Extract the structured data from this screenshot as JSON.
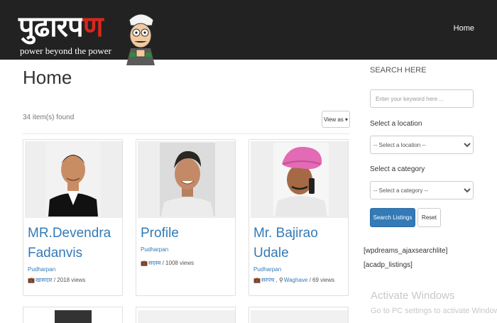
{
  "header": {
    "logo_text_main": "पुढारप",
    "logo_text_accent": "ण",
    "logo_tagline": "power beyond the power",
    "nav": [
      {
        "label": "Home"
      }
    ]
  },
  "main": {
    "title": "Home",
    "count_text": "34 item(s) found",
    "view_as_label": "View as ▾",
    "cards": [
      {
        "name": "MR.Devendra Fadanvis",
        "author": "Pudharpan",
        "category": "खासदार",
        "views": "/ 2018 views"
      },
      {
        "name": "Profile",
        "author": "Pudharpan",
        "category": "सदस्य",
        "views": "/ 1008 views"
      },
      {
        "name": "Mr. Bajirao Udale",
        "author": "Pudharpan",
        "category": "सरपंच",
        "location": "Waghave",
        "views": "/ 69 views"
      }
    ]
  },
  "sidebar": {
    "title": "SEARCH HERE",
    "keyword_placeholder": "Enter your keyword here ...",
    "location_label": "Select a location",
    "location_selected": "-- Select a location --",
    "category_label": "Select a category",
    "category_selected": "-- Select a category --",
    "search_button": "Search Listings",
    "reset_button": "Reset",
    "shortcode_1": "[wpdreams_ajaxsearchlite]",
    "shortcode_2": "[acadp_listings]"
  },
  "watermark": {
    "title": "Activate Windows",
    "subtitle": "Go to PC settings to activate Windows."
  },
  "colors": {
    "header_bg": "#222222",
    "accent_red": "#d9261c",
    "link_blue": "#337ab7"
  },
  "icons": [
    "briefcase-icon",
    "map-marker-icon",
    "caret-down-icon"
  ]
}
